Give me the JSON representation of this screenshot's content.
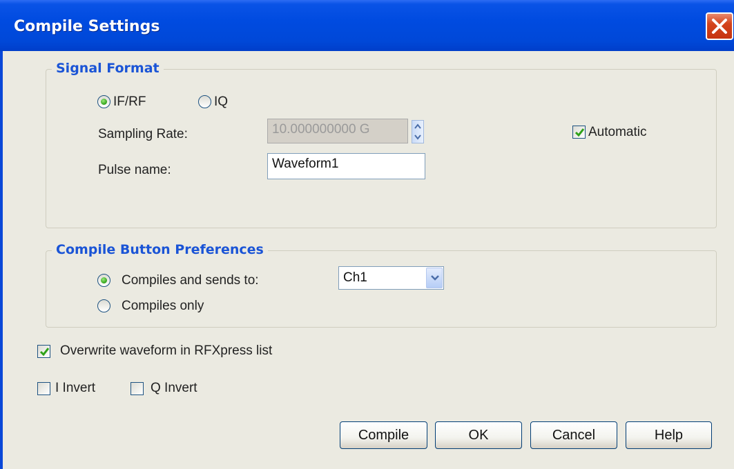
{
  "window": {
    "title": "Compile Settings"
  },
  "signal_format": {
    "title": "Signal Format",
    "mode_options": [
      {
        "label": "IF/RF",
        "selected": true
      },
      {
        "label": "IQ",
        "selected": false
      }
    ],
    "sampling_rate": {
      "label": "Sampling Rate:",
      "value": "10.000000000 G",
      "disabled": true
    },
    "automatic": {
      "label": "Automatic",
      "checked": true
    },
    "pulse_name": {
      "label": "Pulse name:",
      "value": "Waveform1"
    }
  },
  "compile_prefs": {
    "title": "Compile Button Preferences",
    "options": [
      {
        "label": "Compiles and sends to:",
        "selected": true
      },
      {
        "label": "Compiles only",
        "selected": false
      }
    ],
    "channel": {
      "selected": "Ch1"
    }
  },
  "overwrite": {
    "label": "Overwrite waveform in RFXpress list",
    "checked": true
  },
  "i_invert": {
    "label": "I Invert",
    "checked": false
  },
  "q_invert": {
    "label": "Q Invert",
    "checked": false
  },
  "buttons": {
    "compile": "Compile",
    "ok": "OK",
    "cancel": "Cancel",
    "help": "Help"
  },
  "colors": {
    "title_bar": "#0a53e6",
    "group_title": "#1a54d6",
    "dialog_background": "#ebeae1",
    "check_green": "#2fa218"
  },
  "icons": {
    "close": "close-x-icon",
    "check": "checkmark-icon",
    "spin": "spin-up-down-icon",
    "dropdown": "chevron-down-icon"
  }
}
